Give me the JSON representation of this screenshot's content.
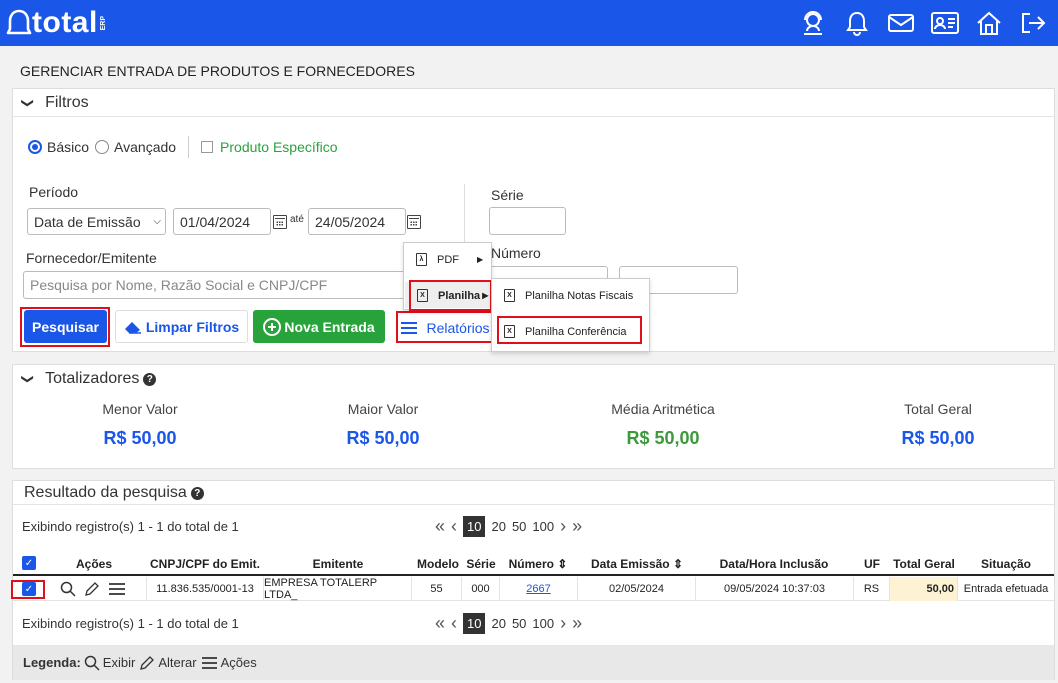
{
  "brand": {
    "name": "total",
    "suffix": "ERP"
  },
  "page_title": "GERENCIAR ENTRADA DE PRODUTOS E FORNECEDORES",
  "filters": {
    "title": "Filtros",
    "basic": "Básico",
    "advanced": "Avançado",
    "specific_product": "Produto Específico",
    "period_label": "Período",
    "period_type": "Data de Emissão",
    "date_from": "01/04/2024",
    "until": "até",
    "date_to": "24/05/2024",
    "supplier_label": "Fornecedor/Emitente",
    "supplier_placeholder": "Pesquisa por Nome, Razão Social e CNPJ/CPF",
    "series_label": "Série",
    "number_label": "Número",
    "search_btn": "Pesquisar",
    "clear_btn": "Limpar Filtros",
    "new_btn": "Nova Entrada",
    "reports_btn": "Relatórios"
  },
  "reports_menu": {
    "pdf": "PDF",
    "sheet": "Planilha",
    "sheet_invoices": "Planilha Notas Fiscais",
    "sheet_conference": "Planilha Conferência"
  },
  "totals": {
    "title": "Totalizadores",
    "min_label": "Menor Valor",
    "min_value": "R$ 50,00",
    "max_label": "Maior Valor",
    "max_value": "R$ 50,00",
    "avg_label": "Média Aritmética",
    "avg_value": "R$ 50,00",
    "total_label": "Total Geral",
    "total_value": "R$ 50,00"
  },
  "results": {
    "title": "Resultado da pesquisa",
    "showing": "Exibindo registro(s) 1 - 1 do total de 1",
    "page_sizes": [
      "10",
      "20",
      "50",
      "100"
    ],
    "columns": {
      "actions": "Ações",
      "cnpj": "CNPJ/CPF do Emit.",
      "issuer": "Emitente",
      "model": "Modelo",
      "series": "Série",
      "number": "Número",
      "issue_date": "Data Emissão",
      "inclusion": "Data/Hora Inclusão",
      "uf": "UF",
      "total": "Total Geral",
      "status": "Situação"
    },
    "row": {
      "cnpj": "11.836.535/0001-13",
      "issuer": "EMPRESA TOTALERP LTDA_",
      "model": "55",
      "series": "000",
      "number": "2667",
      "issue_date": "02/05/2024",
      "inclusion": "09/05/2024 10:37:03",
      "uf": "RS",
      "total": "50,00",
      "status": "Entrada efetuada"
    }
  },
  "legend": {
    "title": "Legenda:",
    "view": "Exibir",
    "edit": "Alterar",
    "actions": "Ações"
  },
  "colors": {
    "primary": "#1a56e8",
    "green": "#28a33c",
    "value_blue": "#1a56e8",
    "value_green": "#3b9a3b",
    "highlight": "#e0101a"
  }
}
